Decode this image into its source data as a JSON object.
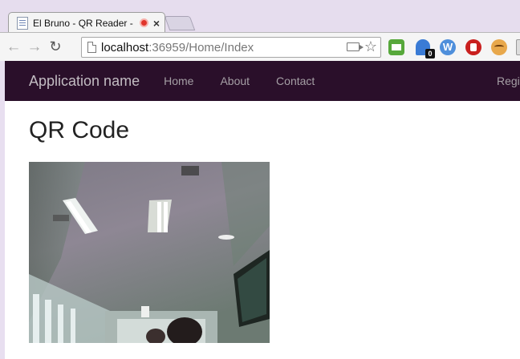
{
  "browser": {
    "tab": {
      "title": "El Bruno - QR Reader -"
    },
    "omnibox": {
      "host": "localhost",
      "rest": ":36959/Home/Index"
    },
    "extensions": {
      "ghost_badge": "0",
      "w_label": "W"
    }
  },
  "app": {
    "brand": "Application name",
    "nav": [
      {
        "label": "Home"
      },
      {
        "label": "About"
      },
      {
        "label": "Contact"
      }
    ],
    "nav_right": "Regi",
    "heading": "QR Code"
  },
  "colors": {
    "navbar": "#2a0f2a",
    "tabstrip": "#e6ddee",
    "record_dot": "#e0342b"
  }
}
